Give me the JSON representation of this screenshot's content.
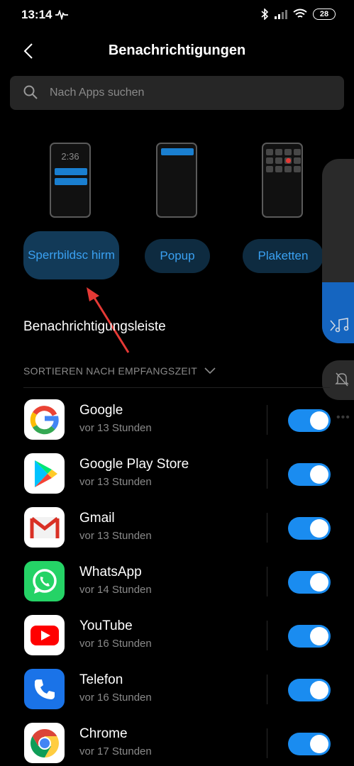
{
  "status_bar": {
    "time": "13:14",
    "battery": "28"
  },
  "header": {
    "title": "Benachrichtigungen"
  },
  "search": {
    "placeholder": "Nach Apps suchen"
  },
  "styles": {
    "lockscreen_label": "Sperrbildsc hirm",
    "lockscreen_time": "2:36",
    "popup_label": "Popup",
    "badges_label": "Plaketten"
  },
  "section": {
    "title": "Benachrichtigungsleiste"
  },
  "sort": {
    "label": "SORTIEREN NACH EMPFANGSZEIT"
  },
  "apps": [
    {
      "name": "Google",
      "time": "vor 13 Stunden",
      "icon": "google-icon",
      "enabled": true
    },
    {
      "name": "Google Play Store",
      "time": "vor 13 Stunden",
      "icon": "play-store-icon",
      "enabled": true
    },
    {
      "name": "Gmail",
      "time": "vor 13 Stunden",
      "icon": "gmail-icon",
      "enabled": true
    },
    {
      "name": "WhatsApp",
      "time": "vor 14 Stunden",
      "icon": "whatsapp-icon",
      "enabled": true
    },
    {
      "name": "YouTube",
      "time": "vor 16 Stunden",
      "icon": "youtube-icon",
      "enabled": true
    },
    {
      "name": "Telefon",
      "time": "vor 16 Stunden",
      "icon": "phone-icon",
      "enabled": true
    },
    {
      "name": "Chrome",
      "time": "vor 17 Stunden",
      "icon": "chrome-icon",
      "enabled": true
    }
  ],
  "colors": {
    "accent": "#1a8cf0",
    "pill_bg": "#0e2b40",
    "pill_text": "#3aa1f2",
    "annotation_arrow": "#e53935"
  }
}
